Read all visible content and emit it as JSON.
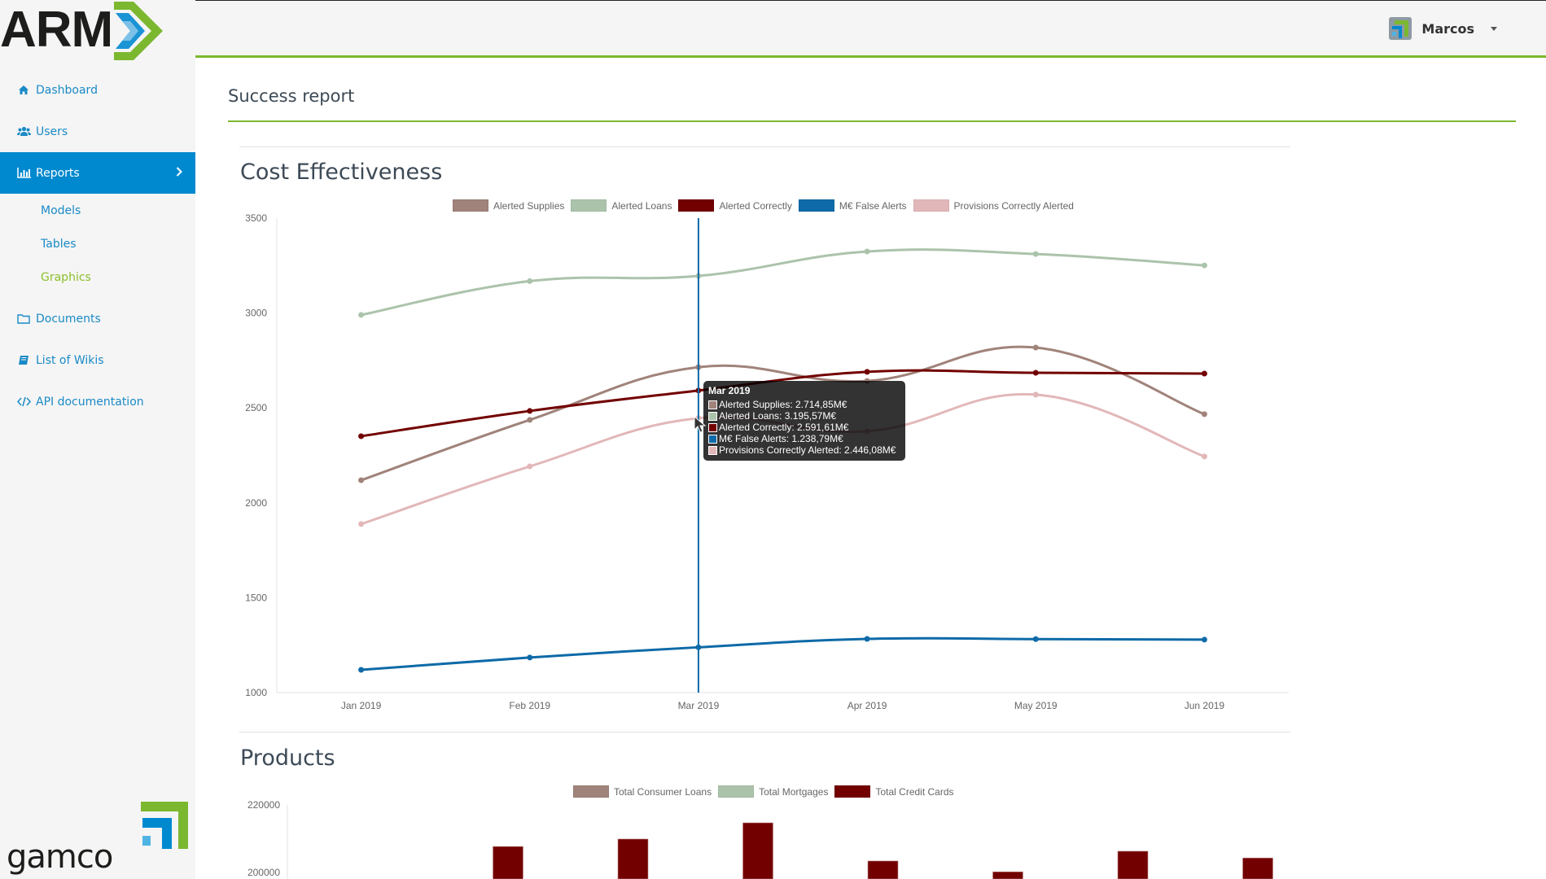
{
  "app": {
    "logo_text": "ARM",
    "footer_logo_text": "gamco"
  },
  "header": {
    "user_name": "Marcos"
  },
  "sidebar": {
    "items": [
      {
        "label": "Dashboard",
        "icon": "home-icon"
      },
      {
        "label": "Users",
        "icon": "users-icon"
      },
      {
        "label": "Reports",
        "icon": "bar-chart-icon",
        "active": true
      },
      {
        "label": "Documents",
        "icon": "folder-icon"
      },
      {
        "label": "List of Wikis",
        "icon": "book-icon"
      },
      {
        "label": "API documentation",
        "icon": "code-icon"
      }
    ],
    "reports_sub": [
      {
        "label": "Models"
      },
      {
        "label": "Tables"
      },
      {
        "label": "Graphics",
        "current": true
      }
    ]
  },
  "page": {
    "title": "Success report"
  },
  "colors": {
    "accent_green": "#7cb82f",
    "active_blue": "#0089cf",
    "alerted_supplies": "#a0837a",
    "alerted_loans": "#abc3ab",
    "alerted_correctly": "#720000",
    "false_alerts": "#0e6aa8",
    "provisions": "#e2b7b9"
  },
  "tooltip": {
    "title": "Mar 2019",
    "rows": [
      "Alerted Supplies: 2.714,85M€",
      "Alerted Loans: 3.195,57M€",
      "Alerted Correctly: 2.591,61M€",
      "M€ False Alerts: 1.238,79M€",
      "Provisions Correctly Alerted: 2.446,08M€"
    ]
  },
  "chart_data": [
    {
      "type": "line",
      "title": "Cost Effectiveness",
      "xlabel": "",
      "ylabel": "",
      "categories": [
        "Jan 2019",
        "Feb 2019",
        "Mar 2019",
        "Apr 2019",
        "May 2019",
        "Jun 2019"
      ],
      "ylim": [
        1000,
        3500
      ],
      "yticks": [
        "3500",
        "3000",
        "2500",
        "2000",
        "1500",
        "1000"
      ],
      "legend": "top",
      "grid": false,
      "hover_category": "Mar 2019",
      "series": [
        {
          "name": "Alerted Supplies",
          "color": "#a0837a",
          "values": [
            2119,
            2437,
            2714.85,
            2642,
            2818,
            2467
          ]
        },
        {
          "name": "Alerted Loans",
          "color": "#abc3ab",
          "values": [
            2990,
            3168,
            3195.57,
            3324,
            3311,
            3251
          ]
        },
        {
          "name": "Alerted Correctly",
          "color": "#720000",
          "values": [
            2351,
            2484,
            2591.61,
            2690,
            2685,
            2681
          ]
        },
        {
          "name": "M€ False Alerts",
          "color": "#0e6aa8",
          "values": [
            1120,
            1185,
            1238.79,
            1283,
            1282,
            1279
          ]
        },
        {
          "name": "Provisions Correctly Alerted",
          "color": "#e2b7b9",
          "values": [
            1888,
            2192,
            2446.08,
            2377,
            2570,
            2244
          ]
        }
      ]
    },
    {
      "type": "bar",
      "title": "Products",
      "xlabel": "",
      "ylabel": "",
      "ylim": [
        200000,
        220000
      ],
      "yticks": [
        "220000",
        "200000"
      ],
      "legend": "top",
      "grid": false,
      "series": [
        {
          "name": "Total Consumer Loans",
          "color": "#a0837a",
          "values": []
        },
        {
          "name": "Total Mortgages",
          "color": "#abc3ab",
          "values": []
        },
        {
          "name": "Total Credit Cards",
          "color": "#720000",
          "values": [
            207700,
            209900,
            214700,
            203400,
            200200,
            206300,
            204300
          ]
        }
      ]
    }
  ]
}
